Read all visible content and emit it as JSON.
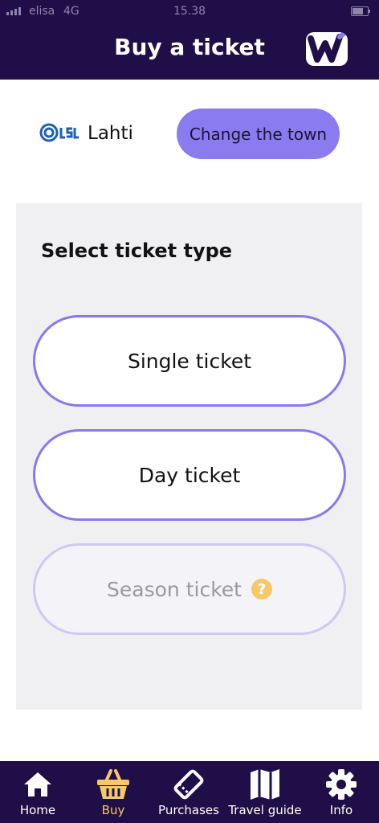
{
  "status_bar": {
    "carrier": "elisa",
    "network": "4G",
    "time": "15.38"
  },
  "header": {
    "title": "Buy a ticket",
    "logo_icon": "w-logo-icon"
  },
  "town": {
    "operator_logo": "lsl-logo-icon",
    "name": "Lahti",
    "change_label": "Change the town"
  },
  "ticket_types": {
    "heading": "Select ticket type",
    "items": [
      {
        "label": "Single ticket",
        "enabled": true
      },
      {
        "label": "Day ticket",
        "enabled": true
      },
      {
        "label": "Season ticket",
        "enabled": false,
        "help": "?"
      }
    ]
  },
  "tabbar": {
    "items": [
      {
        "label": "Home",
        "icon": "home-icon",
        "active": false
      },
      {
        "label": "Buy",
        "icon": "basket-icon",
        "active": true
      },
      {
        "label": "Purchases",
        "icon": "ticket-icon",
        "active": false
      },
      {
        "label": "Travel guide",
        "icon": "map-icon",
        "active": false
      },
      {
        "label": "Info",
        "icon": "gear-icon",
        "active": false
      }
    ]
  },
  "colors": {
    "header_bg": "#1f0e47",
    "accent": "#8b7bf0",
    "active_tab": "#f5c86a",
    "panel_bg": "#f0f0f3"
  }
}
